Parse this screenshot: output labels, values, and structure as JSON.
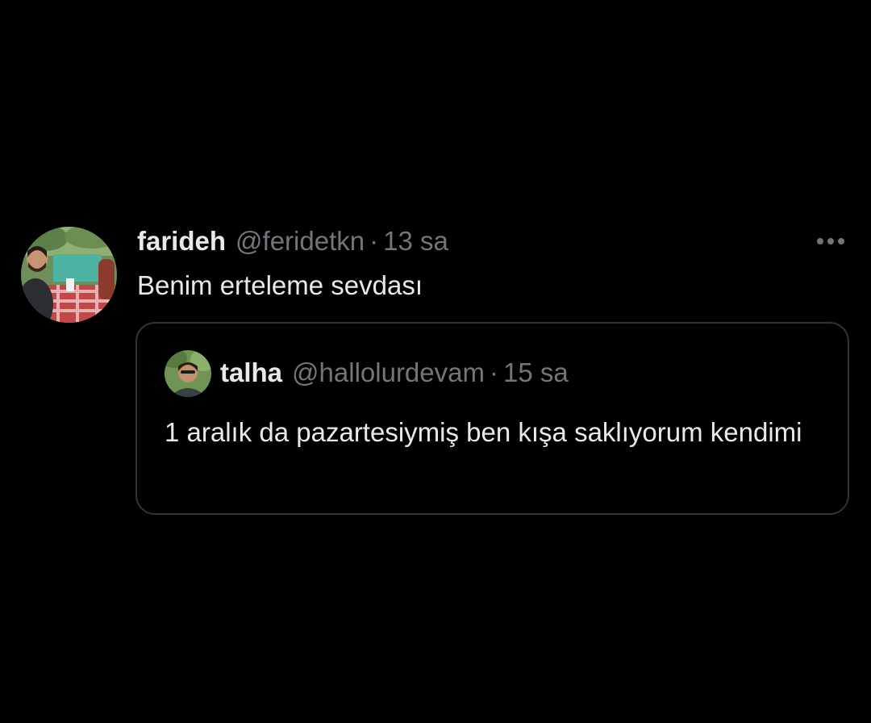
{
  "tweet": {
    "author": {
      "display_name": "farideh",
      "handle": "@feridetkn",
      "avatar_icon": "profile-photo"
    },
    "separator": "·",
    "time": "13 sa",
    "text": "Benim erteleme sevdası",
    "more_icon": "more-horizontal-icon"
  },
  "quoted_tweet": {
    "author": {
      "display_name": "talha",
      "handle": "@hallolurdevam",
      "avatar_icon": "profile-photo"
    },
    "separator": "·",
    "time": "15 sa",
    "text": "1 aralık da pazartesiymiş ben kışa saklıyorum kendimi"
  },
  "colors": {
    "background": "#000000",
    "primary_text": "#e7e9ea",
    "secondary_text": "#71767b",
    "border": "#2f3336"
  }
}
